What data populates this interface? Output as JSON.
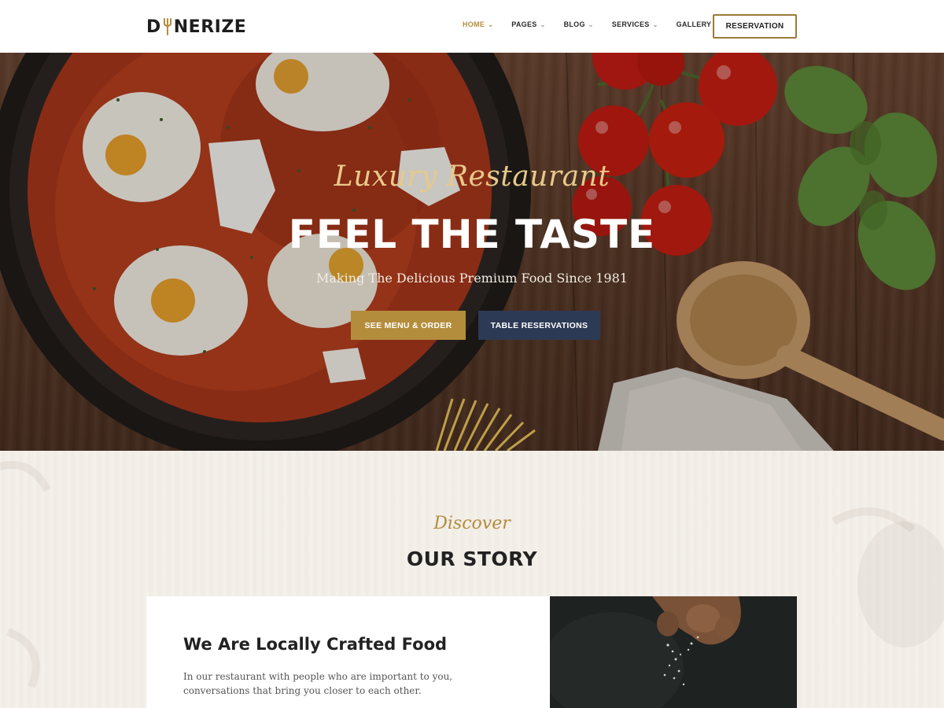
{
  "header": {
    "logo": {
      "pre": "D",
      "post": "NERIZE"
    },
    "nav": [
      {
        "label": "HOME",
        "active": true
      },
      {
        "label": "PAGES",
        "active": false
      },
      {
        "label": "BLOG",
        "active": false
      },
      {
        "label": "SERVICES",
        "active": false
      },
      {
        "label": "GALLERY",
        "active": false
      }
    ],
    "reservation_label": "RESERVATION"
  },
  "hero": {
    "script": "Luxury Restaurant",
    "title": "FEEL THE TASTE",
    "subtitle": "Making The Delicious Premium Food Since 1981",
    "menu_button": "SEE MENU & ORDER",
    "table_button": "TABLE RESERVATIONS"
  },
  "story": {
    "script": "Discover",
    "title": "OUR STORY",
    "card_title": "We Are Locally Crafted Food",
    "card_text": "In our restaurant with people who are important to you, conversations that bring you closer to each other."
  },
  "colors": {
    "accent_gold": "#b48d3c",
    "navy": "#2d3a55",
    "cream": "#f4f0ea"
  },
  "icons": {
    "nav_chevron": "chevron-down-icon",
    "logo_mark": "fork-icon"
  }
}
